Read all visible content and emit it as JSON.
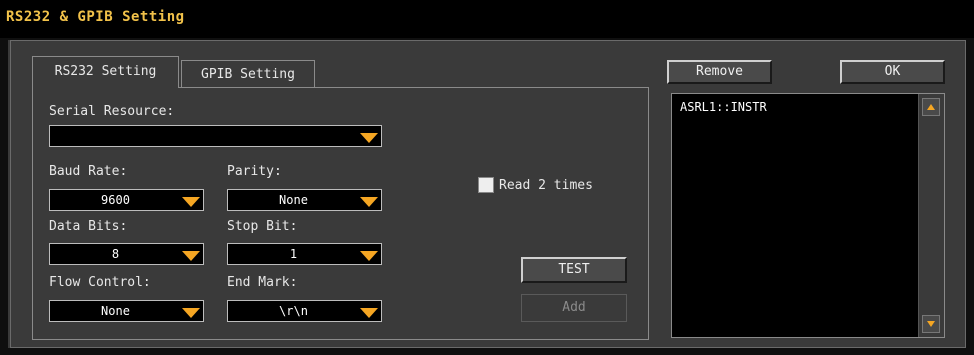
{
  "window": {
    "title": "RS232 & GPIB Setting"
  },
  "tabs": [
    {
      "label": "RS232 Setting",
      "active": true
    },
    {
      "label": "GPIB Setting",
      "active": false
    }
  ],
  "rs232": {
    "serial_resource": {
      "label": "Serial Resource:",
      "value": ""
    },
    "baud_rate": {
      "label": "Baud Rate:",
      "value": "9600"
    },
    "parity": {
      "label": "Parity:",
      "value": "None"
    },
    "data_bits": {
      "label": "Data Bits:",
      "value": "8"
    },
    "stop_bit": {
      "label": "Stop Bit:",
      "value": "1"
    },
    "flow_control": {
      "label": "Flow Control:",
      "value": "None"
    },
    "end_mark": {
      "label": "End Mark:",
      "value": "\\r\\n"
    },
    "read_twice": {
      "label": "Read 2 times",
      "checked": false
    },
    "test_label": "TEST",
    "add_label": "Add"
  },
  "resources": {
    "remove_label": "Remove",
    "ok_label": "OK",
    "items": [
      "ASRL1::INSTR"
    ]
  },
  "colors": {
    "accent": "#f5a623",
    "title": "#f2c24a",
    "background": "#3a3a3a"
  }
}
